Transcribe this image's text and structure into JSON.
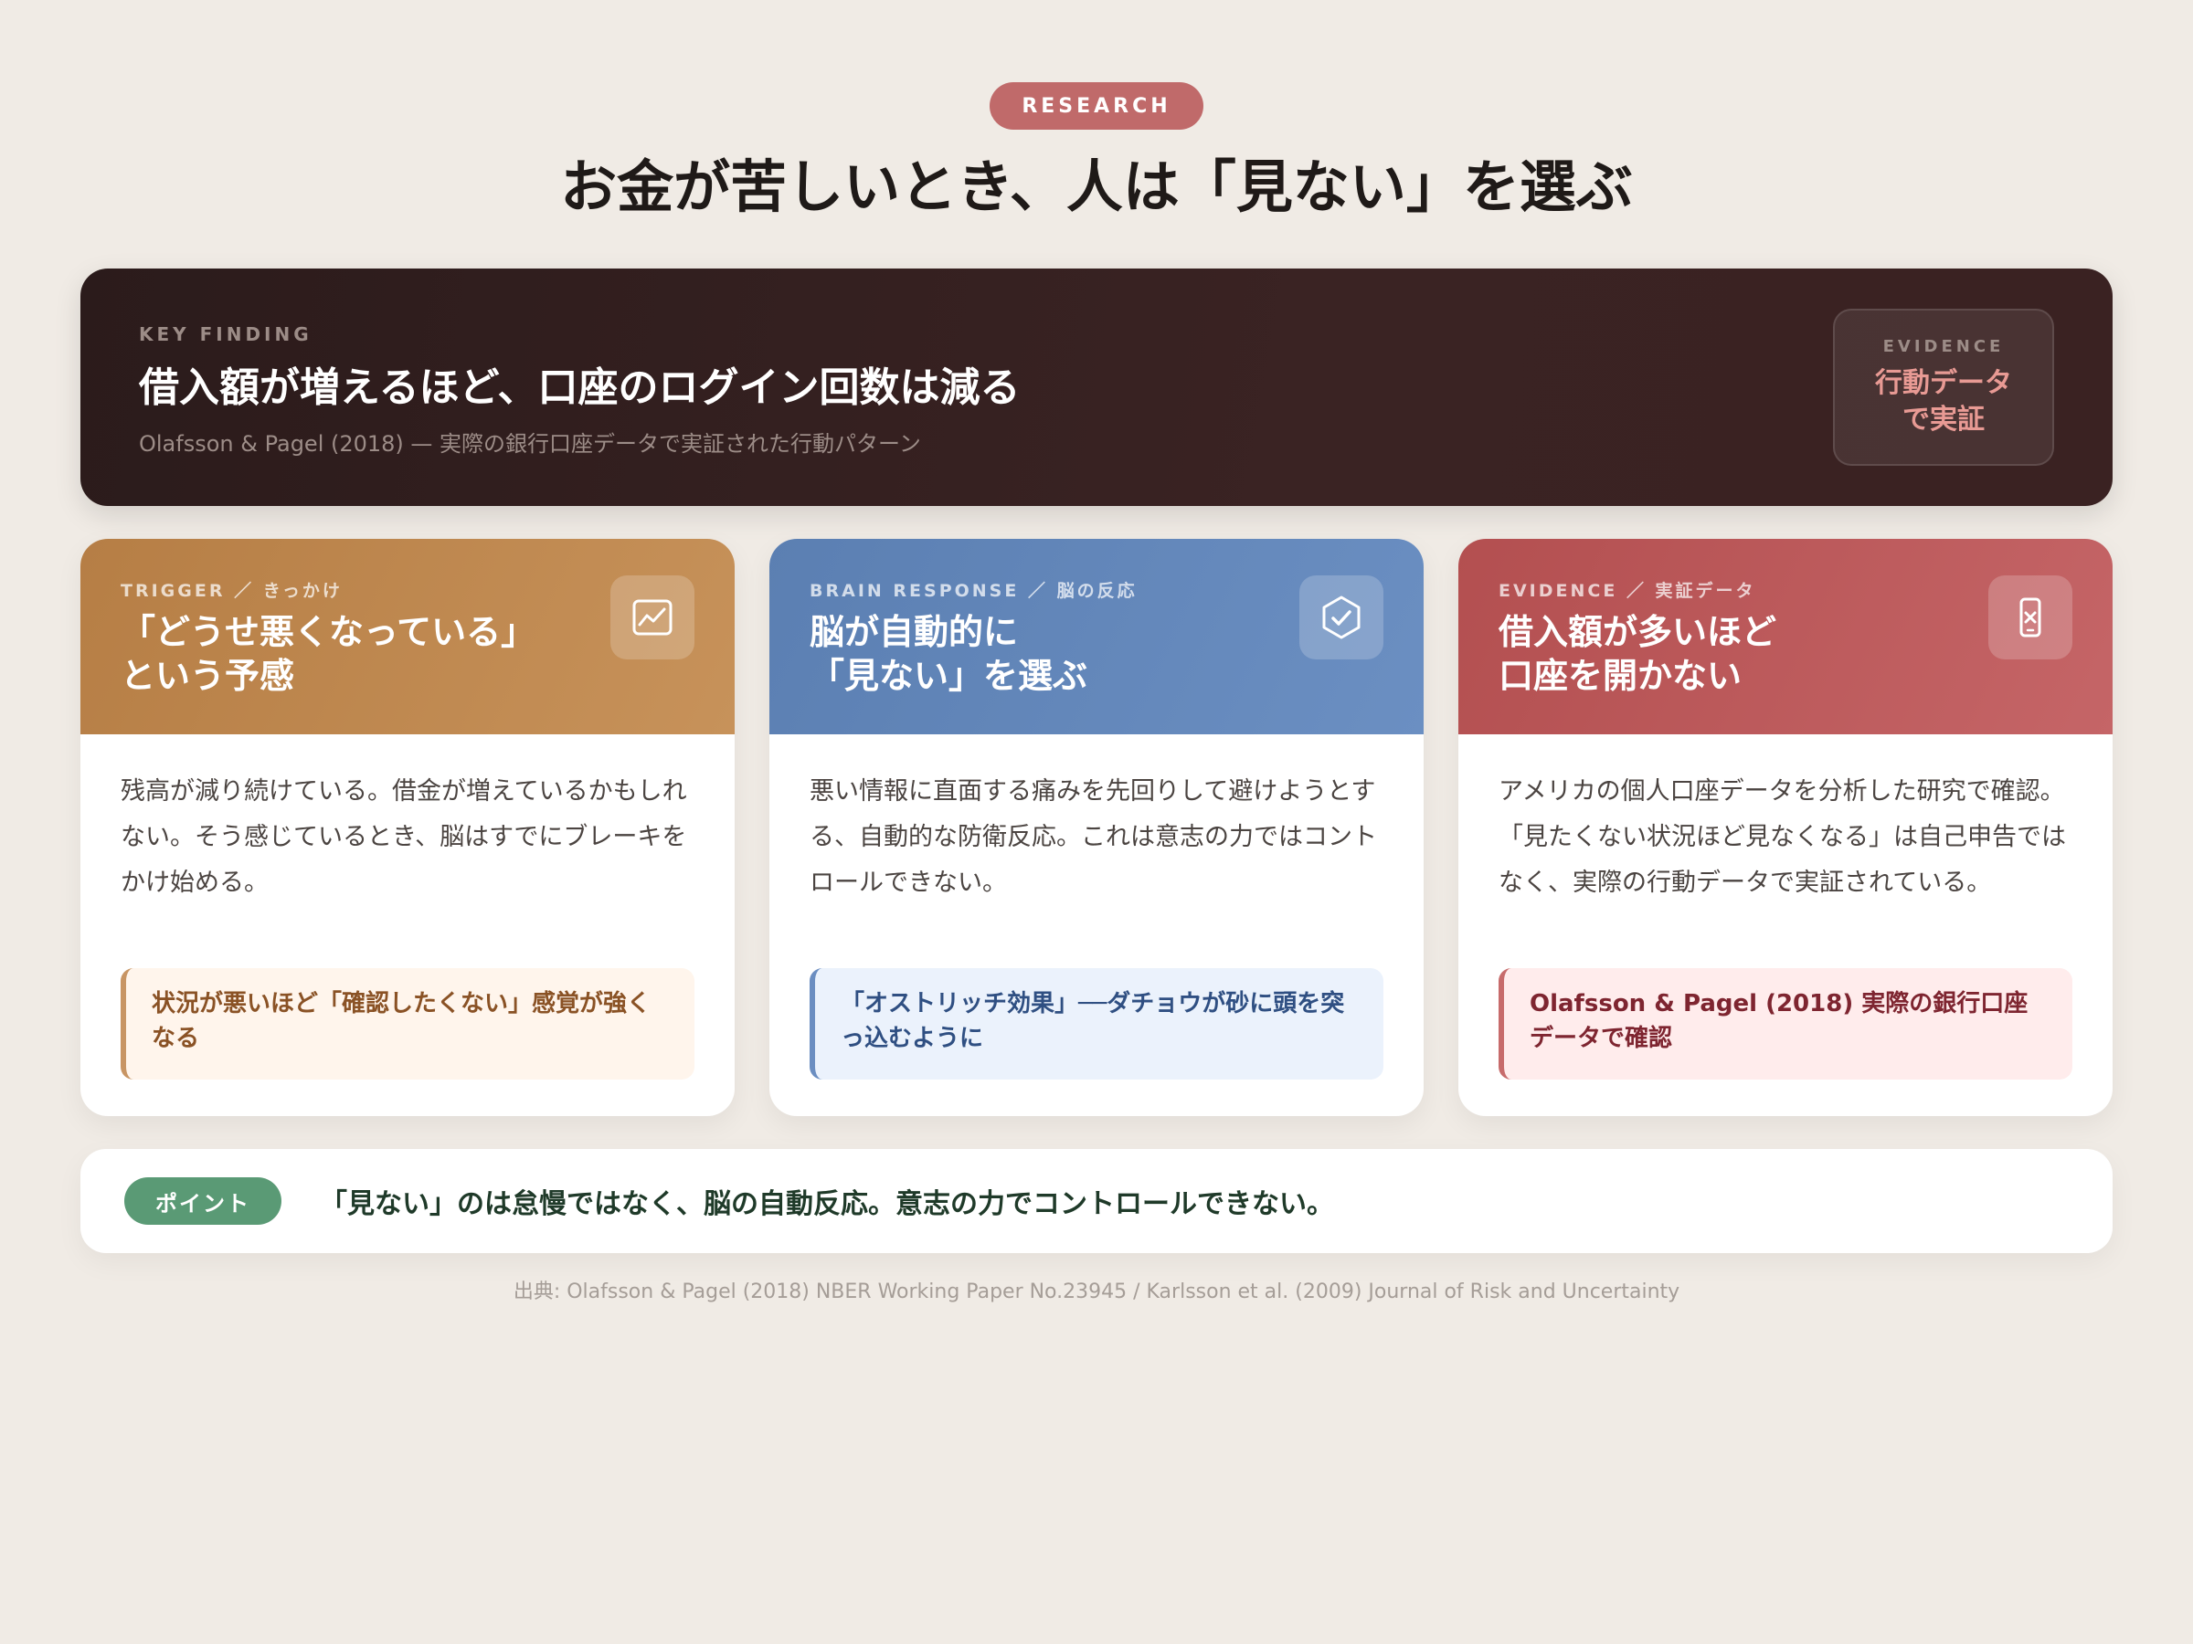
{
  "badge": "RESEARCH",
  "title": "お金が苦しいとき、人は「見ない」を選ぶ",
  "key_finding": {
    "eyebrow": "KEY FINDING",
    "headline": "借入額が増えるほど、口座のログイン回数は減る",
    "subtitle": "Olafsson & Pagel (2018) — 実際の銀行口座データで実証された行動パターン",
    "evidence_label": "EVIDENCE",
    "evidence_value": "行動データで実証"
  },
  "cards": [
    {
      "eyebrow": "TRIGGER ／ きっかけ",
      "heading_line1": "「どうせ悪くなっている」",
      "heading_line2": "という予感",
      "icon": "trend-chart-icon",
      "body": "残高が減り続けている。借金が増えているかもしれない。そう感じているとき、脳はすでにブレーキをかけ始める。",
      "note": "状況が悪いほど「確認したくない」感覚が強くなる"
    },
    {
      "eyebrow": "BRAIN RESPONSE ／ 脳の反応",
      "heading_line1": "脳が自動的に",
      "heading_line2": "「見ない」を選ぶ",
      "icon": "shield-check-icon",
      "body": "悪い情報に直面する痛みを先回りして避けようとする、自動的な防衛反応。これは意志の力ではコントロールできない。",
      "note": "「オストリッチ効果」──ダチョウが砂に頭を突っ込むように"
    },
    {
      "eyebrow": "EVIDENCE ／ 実証データ",
      "heading_line1": "借入額が多いほど",
      "heading_line2": "口座を開かない",
      "icon": "phone-blocked-icon",
      "body": "アメリカの個人口座データを分析した研究で確認。「見たくない状況ほど見なくなる」は自己申告ではなく、実際の行動データで実証されている。",
      "note": "Olafsson & Pagel (2018) 実際の銀行口座データで確認"
    }
  ],
  "point": {
    "label": "ポイント",
    "message": "「見ない」のは怠慢ではなく、脳の自動反応。意志の力でコントロールできない。"
  },
  "source": "出典: Olafsson & Pagel (2018) NBER Working Paper No.23945 / Karlsson et al. (2009) Journal of Risk and Uncertainty",
  "colors": {
    "background": "#f0ebe5",
    "badge": "#c06a6a",
    "hero": "#2f1e1e",
    "trigger": "#bb844c",
    "brain": "#5f83b6",
    "evidence": "#b75456",
    "point": "#5a9a75"
  }
}
